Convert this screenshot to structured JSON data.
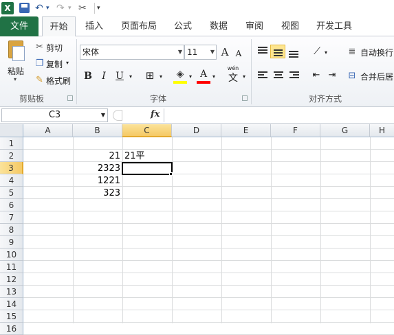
{
  "quick_access": {
    "undo_glyph": "↶",
    "redo_glyph": "↷",
    "more_glyph": "▾",
    "tools_glyph": "✂"
  },
  "tabs": [
    "文件",
    "开始",
    "插入",
    "页面布局",
    "公式",
    "数据",
    "审阅",
    "视图",
    "开发工具"
  ],
  "clipboard": {
    "paste": "粘贴",
    "cut": "剪切",
    "copy": "复制",
    "format_painter": "格式刷",
    "group": "剪贴板"
  },
  "font": {
    "name": "宋体",
    "size": "11",
    "grow": "A",
    "shrink": "A",
    "bold": "B",
    "italic": "I",
    "underline": "U",
    "color_letter": "A",
    "wen": "wén",
    "wen_char": "文",
    "group": "字体"
  },
  "alignment": {
    "wrap": "自动换行",
    "merge": "合并后居",
    "group": "对齐方式"
  },
  "formula_bar": {
    "name_box": "C3",
    "fx": "fx",
    "value": ""
  },
  "sheet": {
    "columns": [
      "A",
      "B",
      "C",
      "D",
      "E",
      "F",
      "G",
      "H"
    ],
    "rows": [
      "1",
      "2",
      "3",
      "4",
      "5",
      "6",
      "7",
      "8",
      "9",
      "10",
      "11",
      "12",
      "13",
      "14",
      "15",
      "16"
    ],
    "cells": {
      "B2": "21",
      "C2": "21平",
      "B3": "2323",
      "B4": "1221",
      "B5": "323"
    },
    "active_cell": "C3"
  },
  "colors": {
    "file_tab": "#207245",
    "selected_header": "#f5c965",
    "highlight_fill": "#ffff00",
    "font_color": "#ff0000"
  }
}
